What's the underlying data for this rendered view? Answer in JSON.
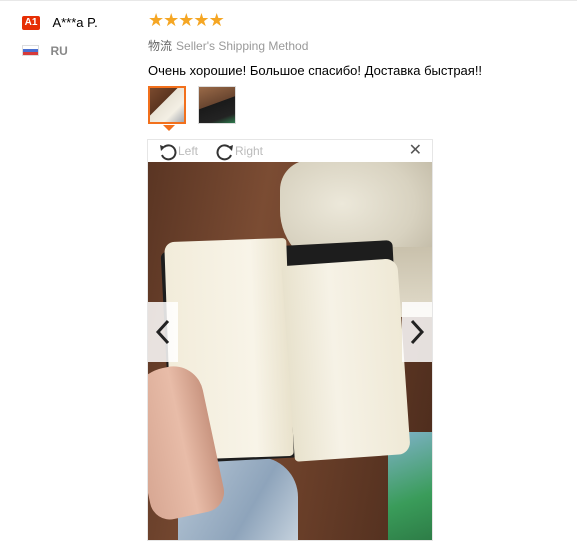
{
  "user": {
    "level_badge": "A1",
    "name": "A***a P.",
    "country": "RU",
    "flag_icon": "russia-flag-icon"
  },
  "review": {
    "rating_stars": 5,
    "shipping_prefix": "物流",
    "shipping_method": "Seller's Shipping Method",
    "feedback_text": "Очень хорошие! Большое спасибо! Доставка быстрая!!"
  },
  "viewer": {
    "rotate_left_label": "Left",
    "rotate_right_label": "Right",
    "close_glyph": "✕",
    "prev_glyph": "‹",
    "next_glyph": "›",
    "selected_thumbnail": 1,
    "thumbnail_count": 2
  },
  "colors": {
    "accent": "#f2701c",
    "badge": "#e62e04",
    "star": "#f5a623"
  }
}
